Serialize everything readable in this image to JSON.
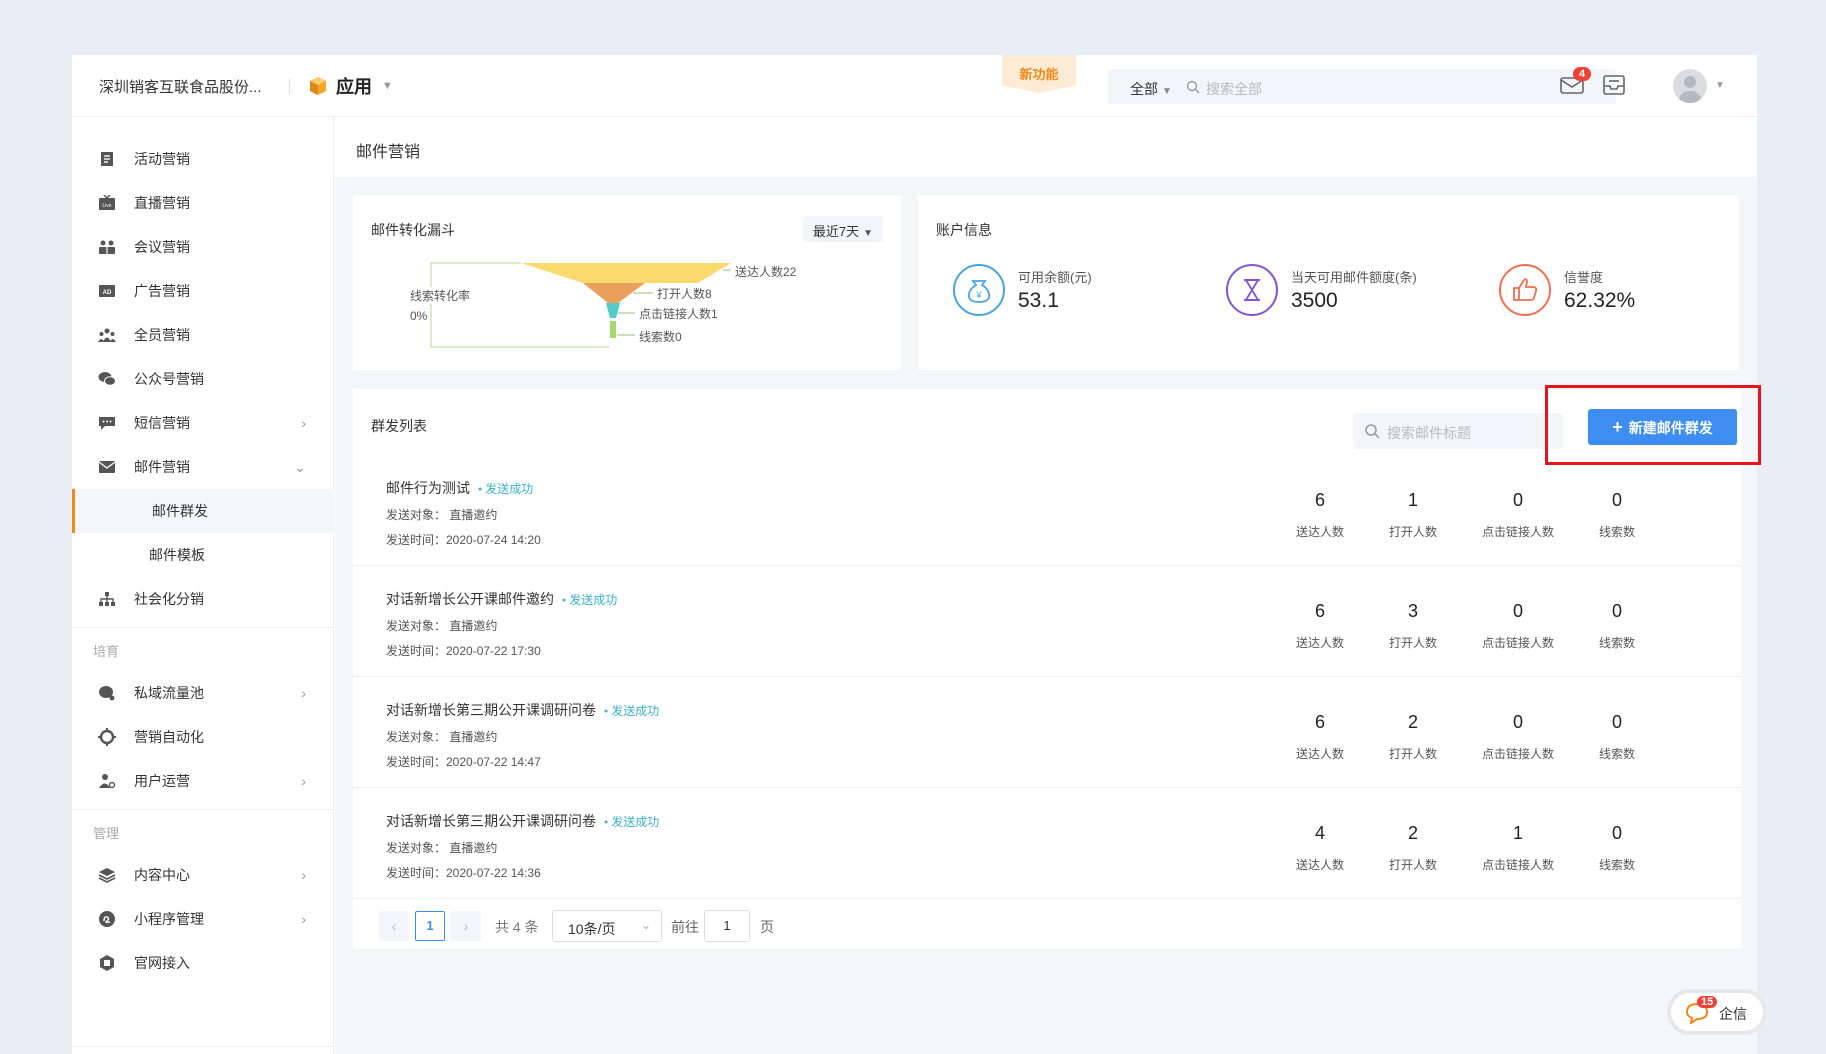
{
  "header": {
    "company": "深圳销客互联食品股份...",
    "apps_label": "应用",
    "new_feature": "新功能",
    "search_scope": "全部",
    "search_placeholder": "搜索全部",
    "mail_badge": "4"
  },
  "sidebar": {
    "top_items": [
      {
        "label": "活动营销",
        "icon": "document-icon"
      },
      {
        "label": "直播营销",
        "icon": "live-icon"
      },
      {
        "label": "会议营销",
        "icon": "meeting-icon"
      },
      {
        "label": "广告营销",
        "icon": "ad-icon"
      },
      {
        "label": "全员营销",
        "icon": "team-icon"
      },
      {
        "label": "公众号营销",
        "icon": "wechat-icon"
      },
      {
        "label": "短信营销",
        "icon": "sms-icon"
      },
      {
        "label": "邮件营销",
        "icon": "mail-icon"
      }
    ],
    "mail_sub": [
      "邮件群发",
      "邮件模板"
    ],
    "social": "社会化分销",
    "group_nurture": "培育",
    "nurture_items": [
      "私域流量池",
      "营销自动化",
      "用户运营"
    ],
    "group_manage": "管理",
    "manage_items": [
      "内容中心",
      "小程序管理",
      "官网接入"
    ]
  },
  "main": {
    "breadcrumb": "邮件营销",
    "funnel": {
      "title": "邮件转化漏斗",
      "range": "最近7天",
      "delivered": "送达人数22",
      "opened": "打开人数8",
      "clicked": "点击链接人数1",
      "leads": "线索数0",
      "rate_label": "线索转化率",
      "rate_value": "0%"
    },
    "account": {
      "title": "账户信息",
      "balance_label": "可用余额(元)",
      "balance_value": "53.1",
      "quota_label": "当天可用邮件额度(条)",
      "quota_value": "3500",
      "credit_label": "信誉度",
      "credit_value": "62.32%"
    },
    "list": {
      "title": "群发列表",
      "search_placeholder": "搜索邮件标题",
      "new_button": "新建邮件群发",
      "stat_labels": [
        "送达人数",
        "打开人数",
        "点击链接人数",
        "线索数"
      ],
      "rows": [
        {
          "title": "邮件行为测试",
          "status": "发送成功",
          "target": "发送对象： 直播邀约",
          "time": "发送时间：2020-07-24 14:20",
          "stats": [
            "6",
            "1",
            "0",
            "0"
          ]
        },
        {
          "title": "对话新增长公开课邮件邀约",
          "status": "发送成功",
          "target": "发送对象： 直播邀约",
          "time": "发送时间：2020-07-22 17:30",
          "stats": [
            "6",
            "3",
            "0",
            "0"
          ]
        },
        {
          "title": "对话新增长第三期公开课调研问卷",
          "status": "发送成功",
          "target": "发送对象： 直播邀约",
          "time": "发送时间：2020-07-22 14:47",
          "stats": [
            "6",
            "2",
            "0",
            "0"
          ]
        },
        {
          "title": "对话新增长第三期公开课调研问卷",
          "status": "发送成功",
          "target": "发送对象： 直播邀约",
          "time": "发送时间：2020-07-22 14:36",
          "stats": [
            "4",
            "2",
            "1",
            "0"
          ]
        }
      ]
    },
    "pager": {
      "current": "1",
      "total": "共 4 条",
      "page_size": "10条/页",
      "goto": "前往",
      "goto_value": "1",
      "page_unit": "页"
    }
  },
  "float": {
    "label": "企信",
    "badge": "15"
  },
  "colors": {
    "accent": "#3d8ef0",
    "brand_orange": "#f08a1c",
    "highlight_box": "#e6141b"
  }
}
